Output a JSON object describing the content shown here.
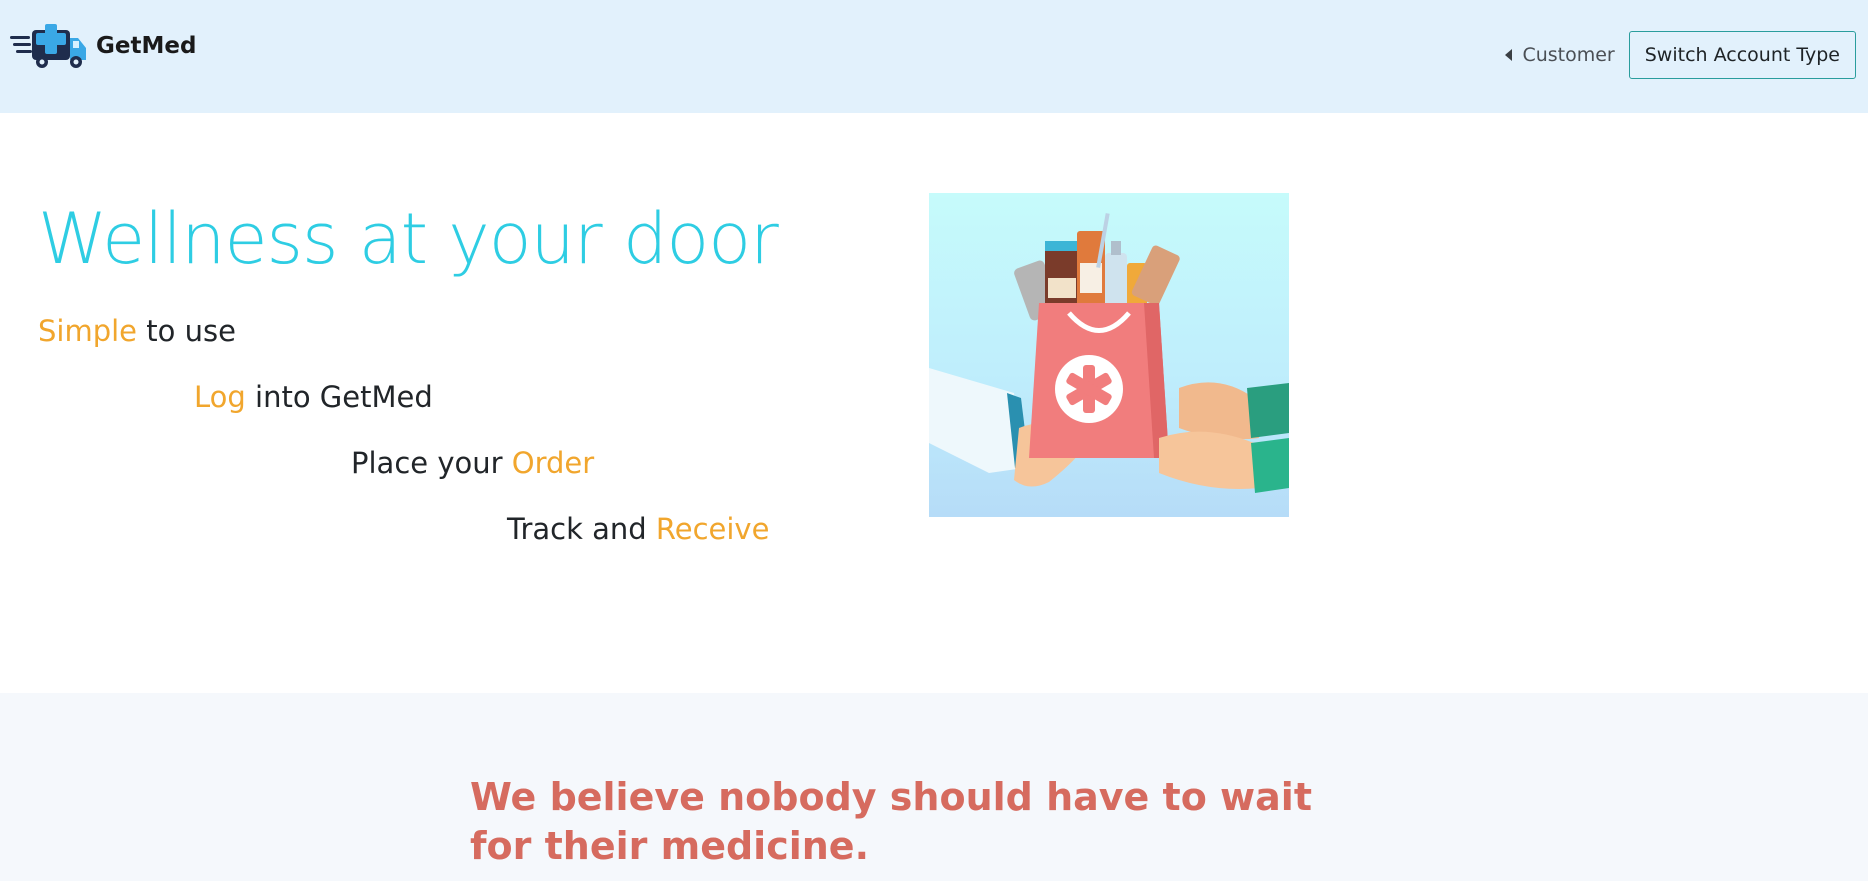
{
  "brand": {
    "name": "GetMed",
    "logo_icon": "delivery-truck-medical-icon"
  },
  "nav": {
    "account_label": "Customer",
    "switch_button_label": "Switch Account Type"
  },
  "hero": {
    "title": "Wellness at your door",
    "steps": [
      {
        "accent": "Simple",
        "text": " to use"
      },
      {
        "accent": "Log",
        "text": " into GetMed"
      },
      {
        "prefix": "Place your ",
        "accent": "Order"
      },
      {
        "prefix": "Track and ",
        "accent": "Receive"
      }
    ],
    "image_icon": "medicine-bag-handoff-illustration"
  },
  "mission": {
    "text": "We believe nobody should have to wait for their medicine."
  },
  "colors": {
    "header_bg": "#e2f1fc",
    "title": "#2ecde3",
    "accent": "#f1a62d",
    "mission": "#d66b5f",
    "button_border": "#2a9d9d"
  }
}
